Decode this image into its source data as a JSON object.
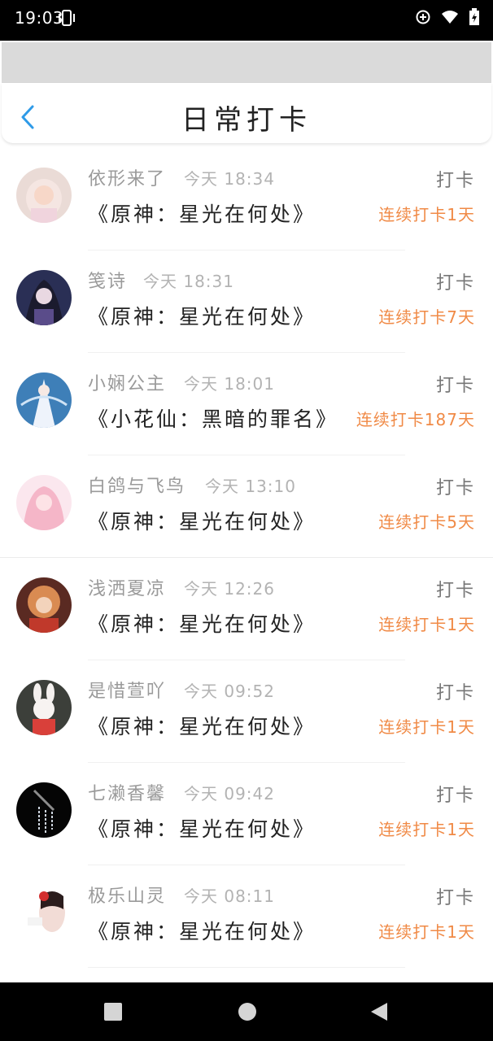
{
  "status": {
    "time": "19:03"
  },
  "header": {
    "title": "日常打卡"
  },
  "entries": [
    {
      "name": "依形来了",
      "time": "今天 18:34",
      "book": "《原神：星光在何处》",
      "action": "打卡",
      "streak": "连续打卡1天"
    },
    {
      "name": "笺诗",
      "time": "今天 18:31",
      "book": "《原神：星光在何处》",
      "action": "打卡",
      "streak": "连续打卡7天"
    },
    {
      "name": "小娴公主",
      "time": "今天 18:01",
      "book": "《小花仙：黑暗的罪名》",
      "action": "打卡",
      "streak": "连续打卡187天"
    },
    {
      "name": "白鸽与飞鸟",
      "time": "今天 13:10",
      "book": "《原神：星光在何处》",
      "action": "打卡",
      "streak": "连续打卡5天"
    },
    {
      "name": "浅洒夏凉",
      "time": "今天 12:26",
      "book": "《原神：星光在何处》",
      "action": "打卡",
      "streak": "连续打卡1天"
    },
    {
      "name": "是惜萱吖",
      "time": "今天 09:52",
      "book": "《原神：星光在何处》",
      "action": "打卡",
      "streak": "连续打卡1天"
    },
    {
      "name": "七濑香馨",
      "time": "今天 09:42",
      "book": "《原神：星光在何处》",
      "action": "打卡",
      "streak": "连续打卡1天"
    },
    {
      "name": "极乐山灵",
      "time": "今天 08:11",
      "book": "《原神：星光在何处》",
      "action": "打卡",
      "streak": "连续打卡1天"
    }
  ],
  "colors": {
    "accent": "#2f9be8",
    "streak": "#f08a46"
  }
}
